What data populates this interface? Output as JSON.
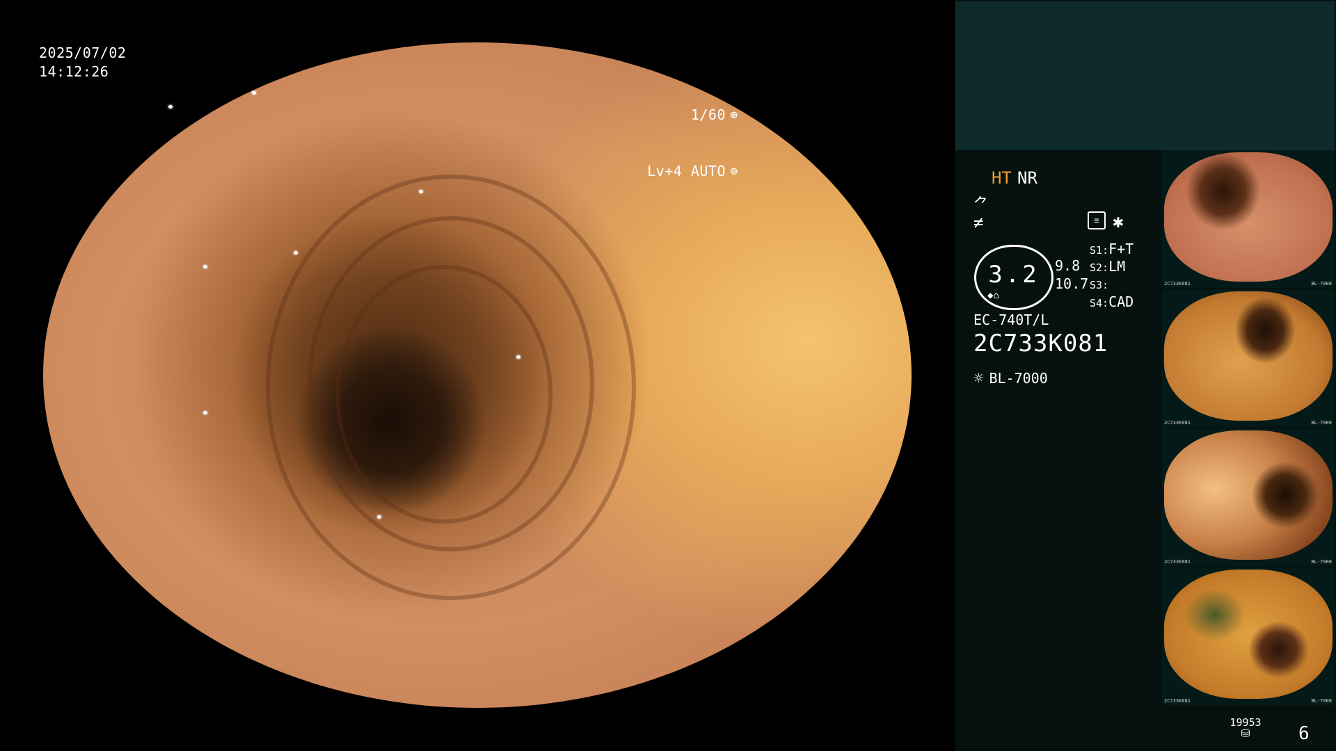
{
  "overlay": {
    "date": "2025/07/02",
    "time": "14:12:26",
    "shutter": "1/60",
    "shutter_icon": "⊛",
    "level": "Lv+4 AUTO",
    "level_icon": "⊚"
  },
  "panel": {
    "mode_ht": "HT",
    "mode_nr": "NR",
    "icon_a": "⺈",
    "icon_b": "≠",
    "icon_c": "≡",
    "icon_d": "✱",
    "zoom_value": "3.2",
    "zoom_tool": "◆⌂",
    "param_1": "9.8",
    "param_2": "10.7",
    "s1_key": "S1:",
    "s1_val": "F+T",
    "s2_key": "S2:",
    "s2_val": "LM",
    "s3_key": "S3:",
    "s3_val": "",
    "s4_key": "S4:",
    "s4_val": "CAD",
    "scope_model": "EC-740T/L",
    "scope_serial": "2C733K081",
    "light_icon": "☼",
    "light_source": "BL-7000"
  },
  "thumbnails": [
    {
      "caption_left": "2C733K081",
      "caption_right": "BL-7000"
    },
    {
      "caption_left": "2C733K081",
      "caption_right": "BL-7000"
    },
    {
      "caption_left": "2C733K081",
      "caption_right": "BL-7000"
    },
    {
      "caption_left": "2C733K081",
      "caption_right": "BL-7000"
    }
  ],
  "footer": {
    "counter": "19953",
    "counter_icon": "⛁",
    "frame_number": "6"
  }
}
